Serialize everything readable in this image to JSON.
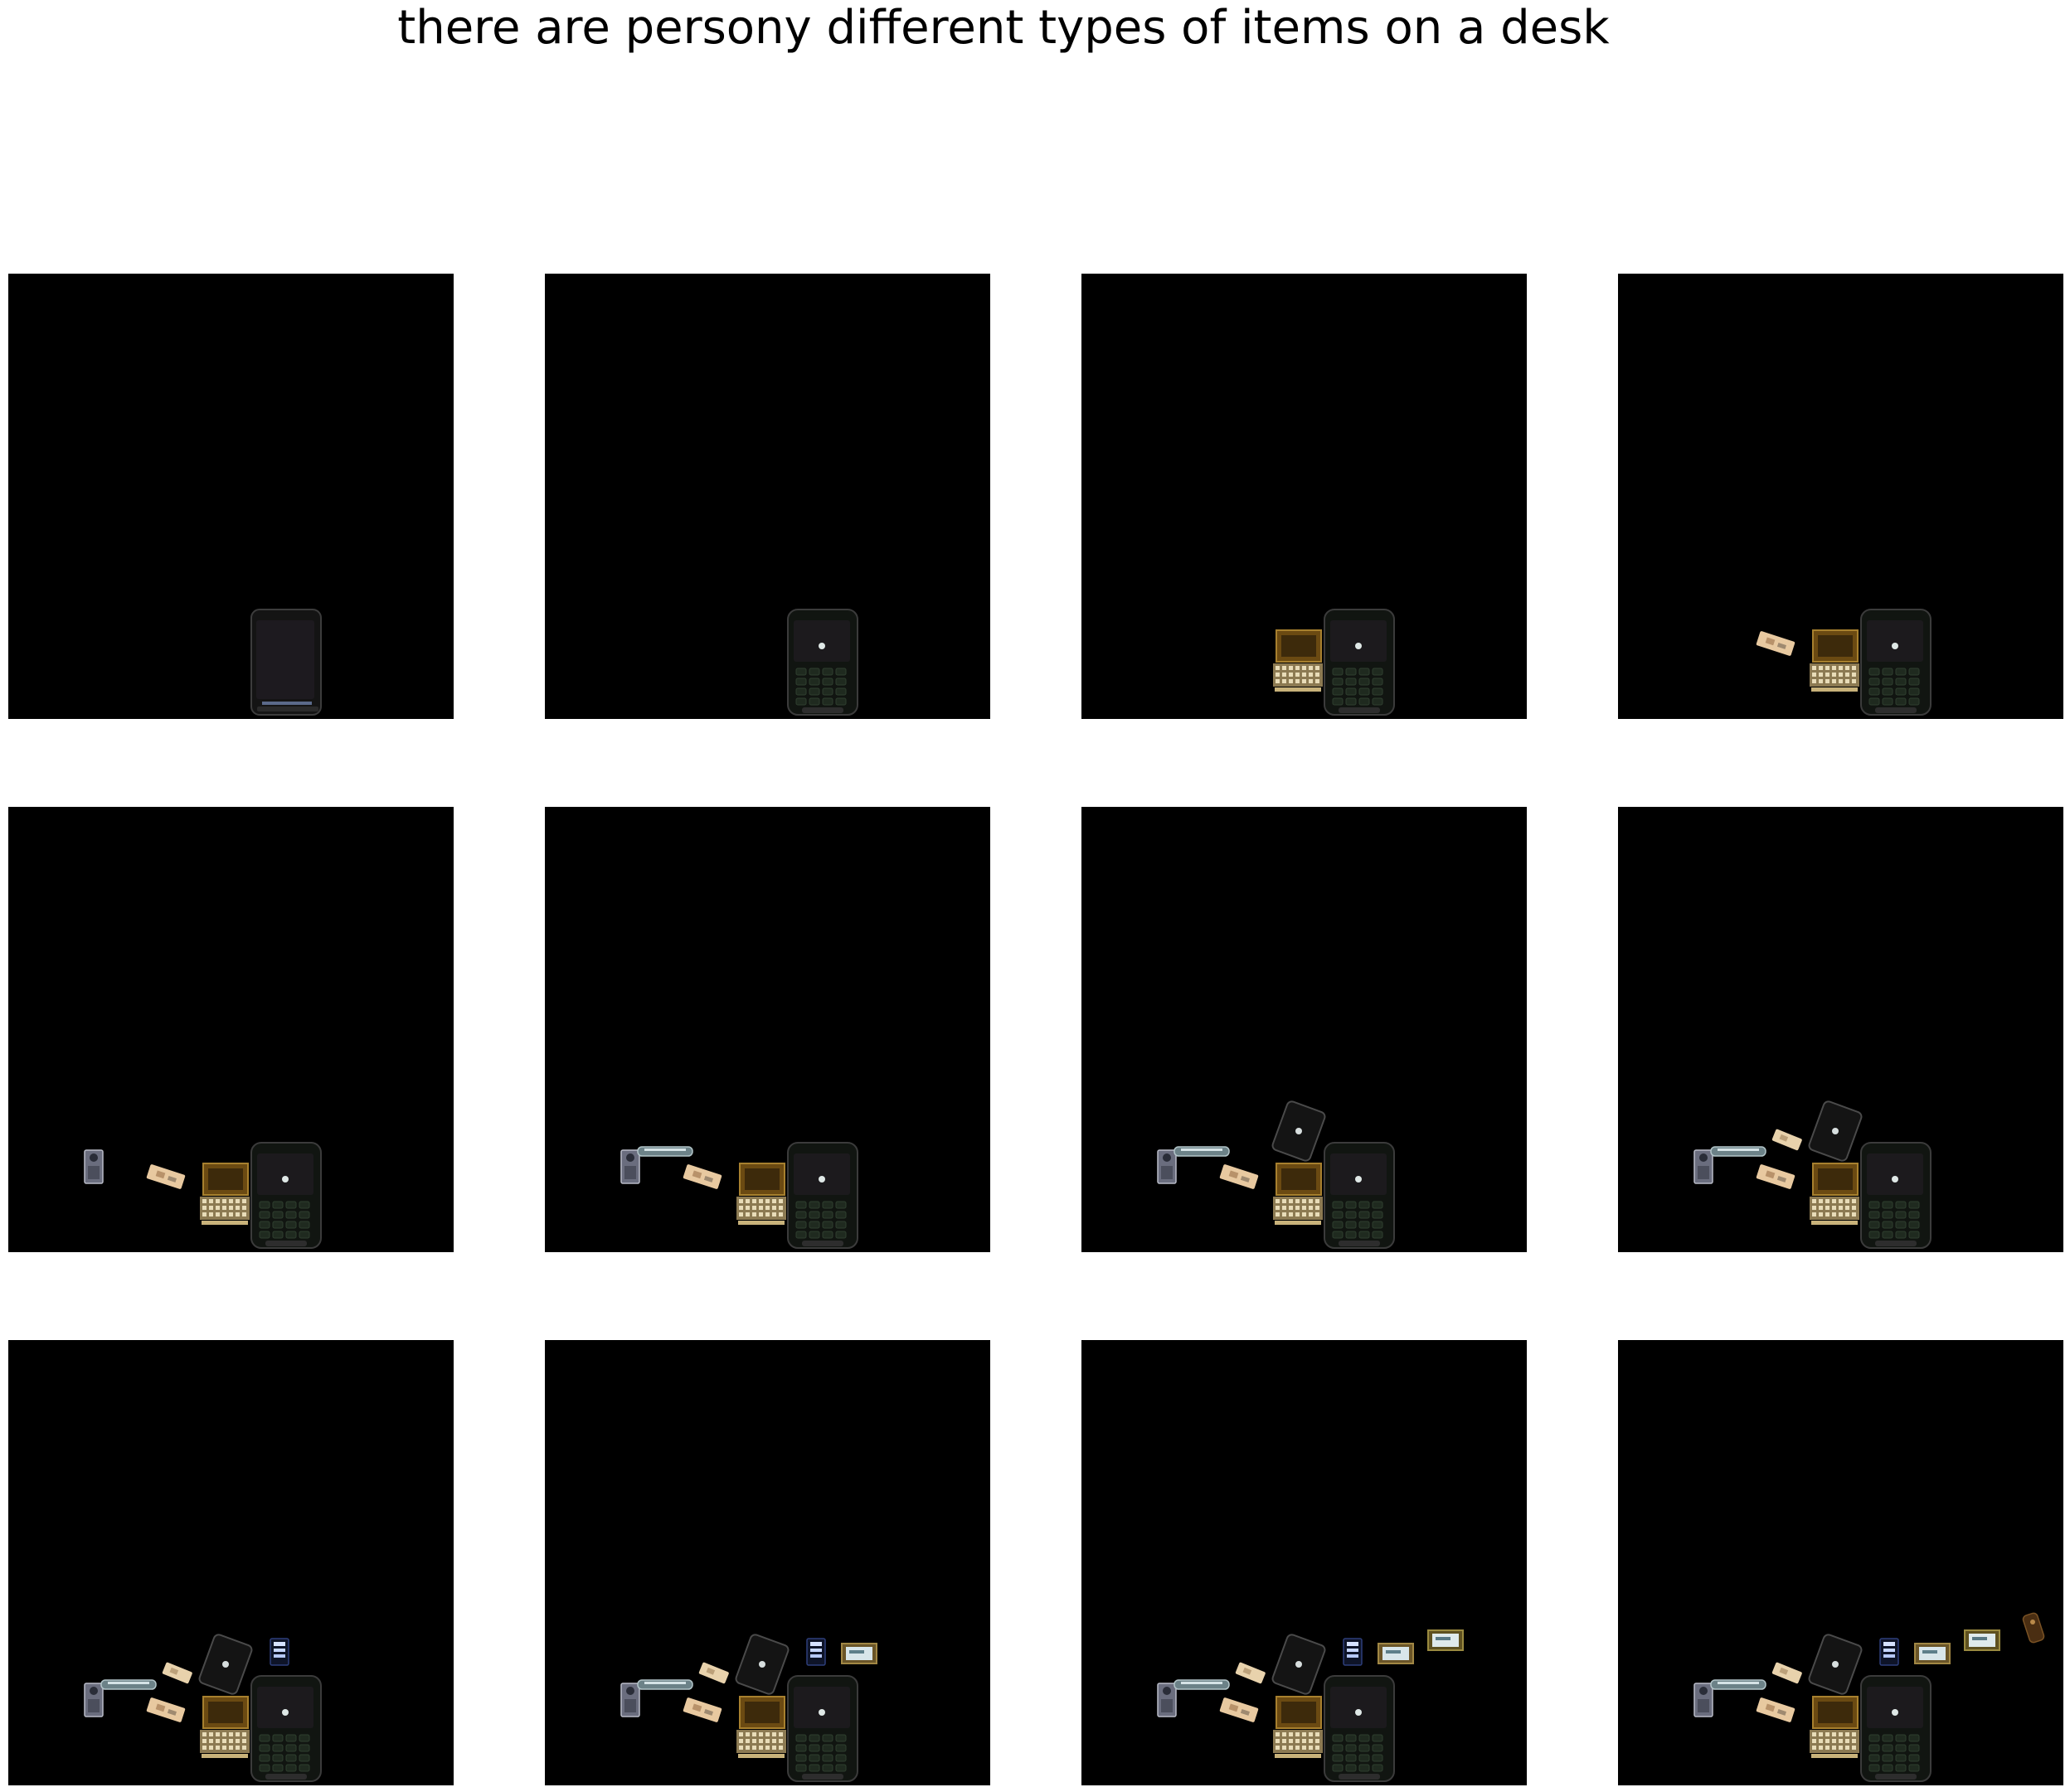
{
  "figure": {
    "title": "there are persony different types of items on a desk",
    "background_color": "#ffffff",
    "panel_background_color": "#000000"
  },
  "panels": [
    {
      "step": 1,
      "objects": [
        "smartphone-dark"
      ]
    },
    {
      "step": 2,
      "objects": [
        "smartphone-keypad"
      ]
    },
    {
      "step": 3,
      "objects": [
        "smartphone-keypad",
        "typewriter"
      ]
    },
    {
      "step": 4,
      "objects": [
        "smartphone-keypad",
        "typewriter",
        "beige-tile"
      ]
    },
    {
      "step": 5,
      "objects": [
        "smartphone-keypad",
        "typewriter",
        "beige-tile",
        "small-camera"
      ]
    },
    {
      "step": 6,
      "objects": [
        "smartphone-keypad",
        "typewriter",
        "beige-tile",
        "small-camera",
        "metal-bar"
      ]
    },
    {
      "step": 7,
      "objects": [
        "smartphone-keypad",
        "typewriter",
        "beige-tile",
        "small-camera",
        "metal-bar",
        "tilted-phone"
      ]
    },
    {
      "step": 8,
      "objects": [
        "smartphone-keypad",
        "typewriter",
        "beige-tile",
        "small-camera",
        "metal-bar",
        "tilted-phone",
        "beige-tile-2"
      ]
    },
    {
      "step": 9,
      "objects": [
        "smartphone-keypad",
        "typewriter",
        "beige-tile",
        "small-camera",
        "metal-bar",
        "tilted-phone",
        "beige-tile-2",
        "blue-screen-device"
      ]
    },
    {
      "step": 10,
      "objects": [
        "smartphone-keypad",
        "typewriter",
        "beige-tile",
        "small-camera",
        "metal-bar",
        "tilted-phone",
        "beige-tile-2",
        "blue-screen-device",
        "framed-card"
      ]
    },
    {
      "step": 11,
      "objects": [
        "smartphone-keypad",
        "typewriter",
        "beige-tile",
        "small-camera",
        "metal-bar",
        "tilted-phone",
        "beige-tile-2",
        "blue-screen-device",
        "framed-card",
        "framed-card-2"
      ]
    },
    {
      "step": 12,
      "objects": [
        "smartphone-keypad",
        "typewriter",
        "beige-tile",
        "small-camera",
        "metal-bar",
        "tilted-phone",
        "beige-tile-2",
        "blue-screen-device",
        "framed-card",
        "framed-card-2",
        "brown-figurine"
      ]
    }
  ]
}
